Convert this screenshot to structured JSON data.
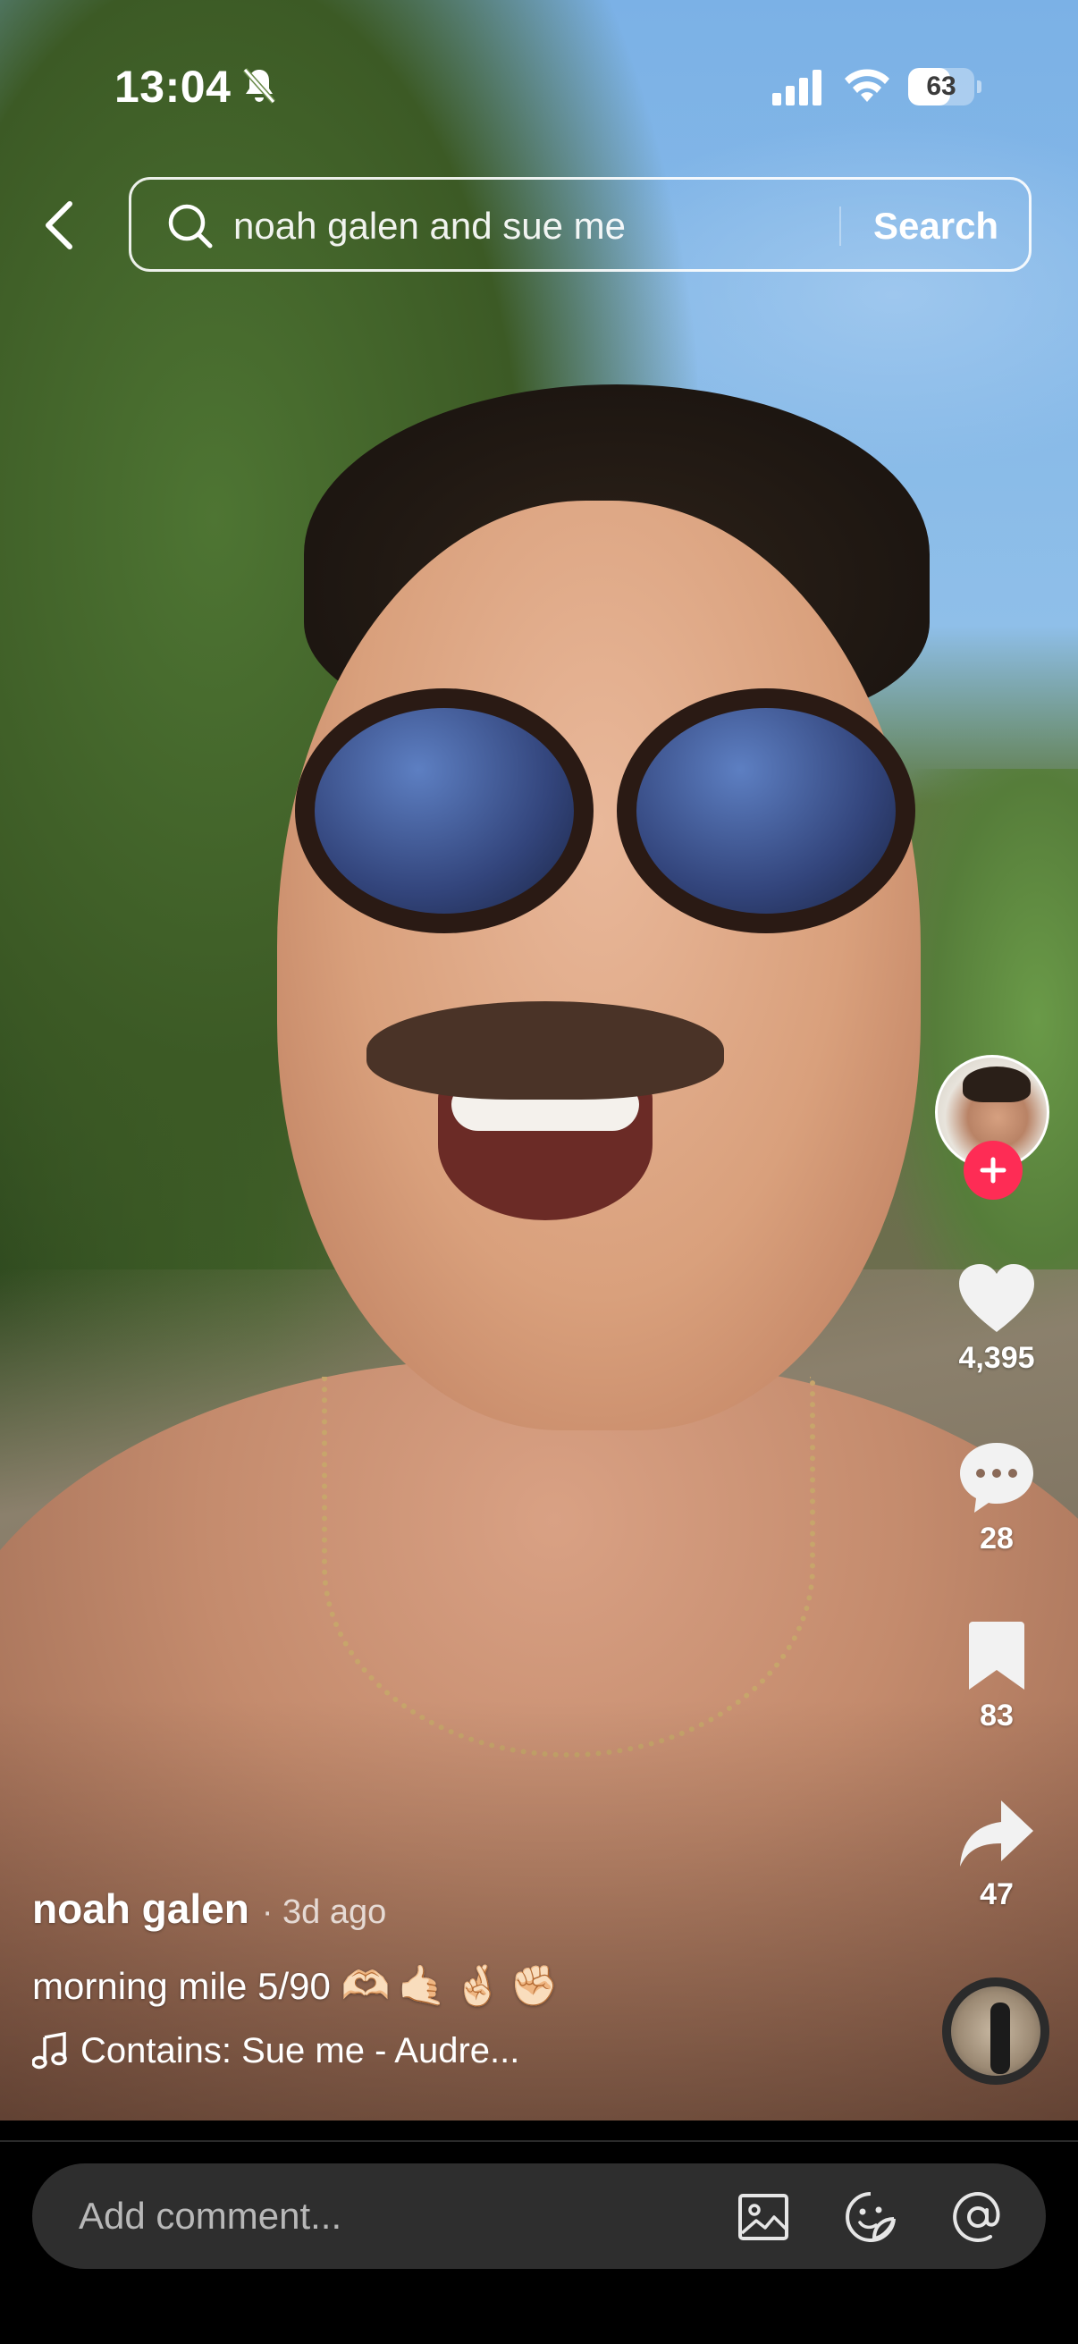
{
  "status_bar": {
    "time": "13:04",
    "battery_level": "63",
    "battery_fraction": 0.63,
    "icons": [
      "bell-off-icon",
      "signal-icon",
      "wifi-icon",
      "battery-icon"
    ]
  },
  "header": {
    "search_query": "noah galen and sue me",
    "search_button": "Search",
    "icons": [
      "back-icon",
      "search-icon"
    ]
  },
  "rail": {
    "likes": "4,395",
    "comments": "28",
    "saves": "83",
    "shares": "47",
    "icons": [
      "heart-icon",
      "comment-bubble-icon",
      "bookmark-icon",
      "share-arrow-icon",
      "plus-icon"
    ],
    "accent_color": "#fe2c55"
  },
  "post": {
    "author": "noah galen",
    "time_ago": "· 3d ago",
    "caption": "morning mile 5/90",
    "emojis": "🫶🏻🤙🏻🤞🏻✊🏻",
    "sound": "Contains: Sue me - Audre..."
  },
  "comment_bar": {
    "placeholder": "Add comment...",
    "icons": [
      "image-icon",
      "sticker-icon",
      "mention-icon"
    ]
  }
}
